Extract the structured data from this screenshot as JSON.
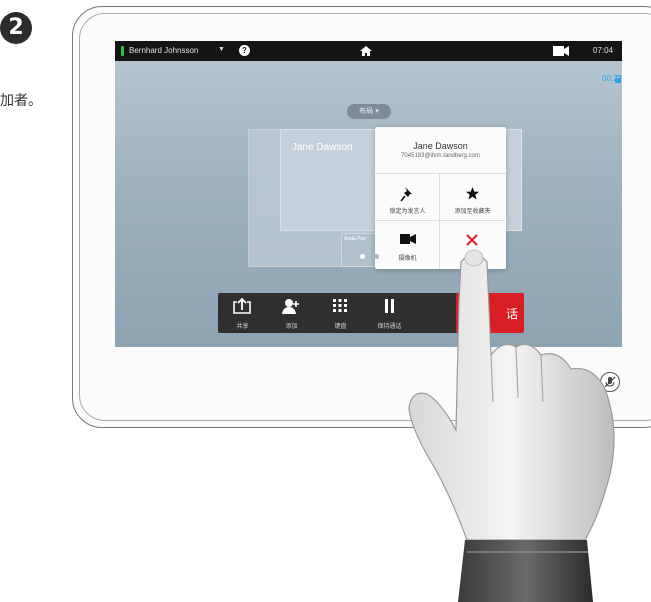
{
  "step": {
    "number": "2",
    "caption": "加者。"
  },
  "topbar": {
    "user_name": "Bernhard Johnsson",
    "caret_icon": "▼",
    "help_icon": "?",
    "time": "07:04"
  },
  "call": {
    "timer": "00:27"
  },
  "layout_button": {
    "label": "布局 ▾"
  },
  "participant": {
    "tile_name": "Jane Dawson",
    "selfview_name": "Anda Pos"
  },
  "popover": {
    "name": "Jane Dawson",
    "address": "7045183@itvm.tandberg.com",
    "actions": [
      {
        "label": "锁定为发言人",
        "icon": "pin-icon"
      },
      {
        "label": "添加至收藏夹",
        "icon": "star-icon"
      },
      {
        "label": "摄像机",
        "icon": "camera-icon"
      },
      {
        "label": "",
        "icon": "close-icon"
      }
    ]
  },
  "callbar": {
    "buttons": [
      {
        "label": "共享",
        "icon": "share-icon"
      },
      {
        "label": "添加",
        "icon": "add-participant-icon"
      },
      {
        "label": "键盘",
        "icon": "keypad-icon"
      },
      {
        "label": "保持通话",
        "icon": "pause-icon"
      }
    ],
    "end_call_label": "话"
  },
  "colors": {
    "accent": "#2ea6e6",
    "end_call": "#d91e26",
    "status_green": "#31c43a",
    "close_red": "#e0242b"
  }
}
